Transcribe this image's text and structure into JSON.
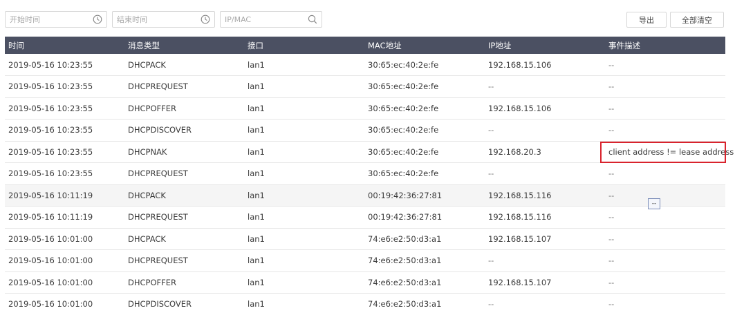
{
  "filters": {
    "start_placeholder": "开始时间",
    "end_placeholder": "结束时间",
    "search_placeholder": "IP/MAC"
  },
  "actions": {
    "export_label": "导出",
    "clear_label": "全部清空"
  },
  "table": {
    "headers": [
      "时间",
      "消息类型",
      "接口",
      "MAC地址",
      "IP地址",
      "事件描述"
    ],
    "rows": [
      [
        "2019-05-16 10:23:55",
        "DHCPACK",
        "lan1",
        "30:65:ec:40:2e:fe",
        "192.168.15.106",
        "--"
      ],
      [
        "2019-05-16 10:23:55",
        "DHCPREQUEST",
        "lan1",
        "30:65:ec:40:2e:fe",
        "--",
        "--"
      ],
      [
        "2019-05-16 10:23:55",
        "DHCPOFFER",
        "lan1",
        "30:65:ec:40:2e:fe",
        "192.168.15.106",
        "--"
      ],
      [
        "2019-05-16 10:23:55",
        "DHCPDISCOVER",
        "lan1",
        "30:65:ec:40:2e:fe",
        "--",
        "--"
      ],
      [
        "2019-05-16 10:23:55",
        "DHCPNAK",
        "lan1",
        "30:65:ec:40:2e:fe",
        "192.168.20.3",
        "client address != lease address"
      ],
      [
        "2019-05-16 10:23:55",
        "DHCPREQUEST",
        "lan1",
        "30:65:ec:40:2e:fe",
        "--",
        "--"
      ],
      [
        "2019-05-16 10:11:19",
        "DHCPACK",
        "lan1",
        "00:19:42:36:27:81",
        "192.168.15.116",
        "--"
      ],
      [
        "2019-05-16 10:11:19",
        "DHCPREQUEST",
        "lan1",
        "00:19:42:36:27:81",
        "192.168.15.116",
        "--"
      ],
      [
        "2019-05-16 10:01:00",
        "DHCPACK",
        "lan1",
        "74:e6:e2:50:d3:a1",
        "192.168.15.107",
        "--"
      ],
      [
        "2019-05-16 10:01:00",
        "DHCPREQUEST",
        "lan1",
        "74:e6:e2:50:d3:a1",
        "--",
        "--"
      ],
      [
        "2019-05-16 10:01:00",
        "DHCPOFFER",
        "lan1",
        "74:e6:e2:50:d3:a1",
        "192.168.15.107",
        "--"
      ],
      [
        "2019-05-16 10:01:00",
        "DHCPDISCOVER",
        "lan1",
        "74:e6:e2:50:d3:a1",
        "--",
        "--"
      ]
    ],
    "hovered_row_index": 6
  },
  "tooltip": {
    "text": "--"
  },
  "colors": {
    "header_bg": "#4b5062",
    "highlight_border": "#d9232d",
    "hover_row_bg": "#f5f5f5"
  },
  "icons": {
    "start_time": "clock-icon",
    "end_time": "clock-icon",
    "search": "search-icon"
  }
}
